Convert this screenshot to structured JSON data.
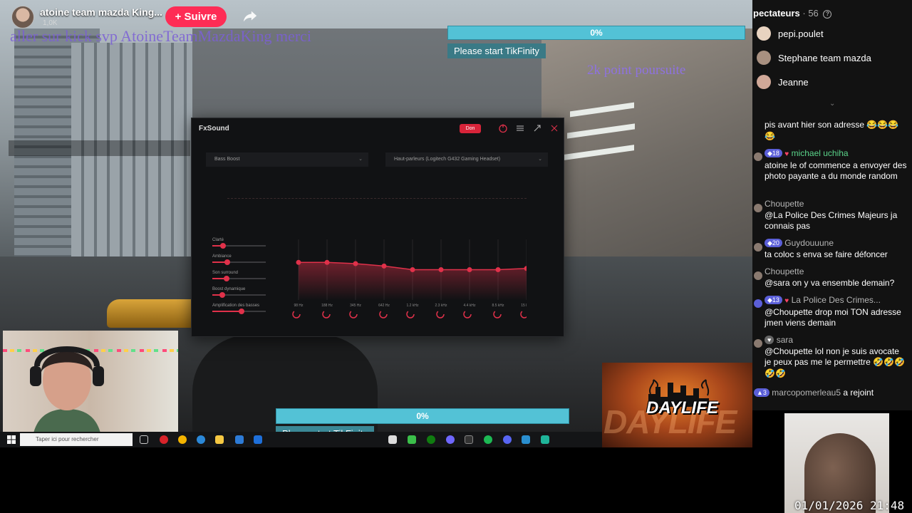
{
  "header": {
    "streamer_name": "atoine team mazda King...",
    "viewer_count": "1,0K",
    "follow_label": "+ Suivre",
    "share_icon": "share-icon"
  },
  "overlays": {
    "kick_message": "aller sur kick svp AtoineTeamMazdaKing merci",
    "points_message": "2k point poursuite"
  },
  "tikfinity_top": {
    "percent": "0%",
    "message": "Please start TikFinity",
    "progress": 0
  },
  "tikfinity_bottom": {
    "percent": "0%",
    "message": "Please start TikFinity",
    "progress": 0
  },
  "fxsound": {
    "title": "FxSound",
    "power_label": "Don",
    "preset": "Bass Boost",
    "output_device": "Haut-parleurs (Logitech G432 Gaming Headset)",
    "effects": [
      {
        "label": "Clarté",
        "level": 0.2
      },
      {
        "label": "Ambiance",
        "level": 0.28
      },
      {
        "label": "Son surround",
        "level": 0.26
      },
      {
        "label": "Boost dynamique",
        "level": 0.18
      },
      {
        "label": "Amplification des basses",
        "level": 0.55
      }
    ],
    "eq_bands": [
      "98 Hz",
      "188 Hz",
      "345 Hz",
      "642 Hz",
      "1.2 kHz",
      "2.3 kHz",
      "4.4 kHz",
      "8.5 kHz",
      "15 kHz"
    ],
    "eq_levels": [
      0.62,
      0.62,
      0.6,
      0.56,
      0.5,
      0.5,
      0.5,
      0.5,
      0.52
    ],
    "accent": "#e0314a"
  },
  "taskbar": {
    "search_placeholder": "Taper ici pour rechercher"
  },
  "daylife": {
    "logo_text": "DAYLIFE",
    "bg_text": "DAYLIFE"
  },
  "chat": {
    "spectators_label": "pectateurs",
    "spectators_count": "56",
    "top_viewers": [
      "pepi.poulet",
      "Stephane team mazda",
      "Jeanne"
    ],
    "messages": [
      {
        "user": "",
        "badge": "",
        "text": "pis avant hier son adresse 😂😂😂😂"
      },
      {
        "user": "michael uchiha",
        "badge": "18",
        "text": "atoine le of commence a envoyer des photo payante a du monde random"
      },
      {
        "user": "Choupette",
        "badge": "",
        "text": "@La Police Des Crimes Majeurs ja connais pas"
      },
      {
        "user": "Guydouuune",
        "badge": "20",
        "text": "ta coloc s enva se faire défoncer"
      },
      {
        "user": "Choupette",
        "badge": "",
        "text": "@sara on y va ensemble demain?"
      },
      {
        "user": "La Police Des Crimes...",
        "badge": "13",
        "text": "@Choupette drop moi TON adresse jmen viens demain"
      },
      {
        "user": "sara",
        "badge": "",
        "text": "@Choupette lol non je suis avocate je peux pas me le permettre 🤣🤣🤣🤣🤣"
      },
      {
        "user": "marcopomerleau5",
        "badge": "3",
        "text": "a rejoint"
      }
    ]
  },
  "clock": "01/01/2026 21:48"
}
